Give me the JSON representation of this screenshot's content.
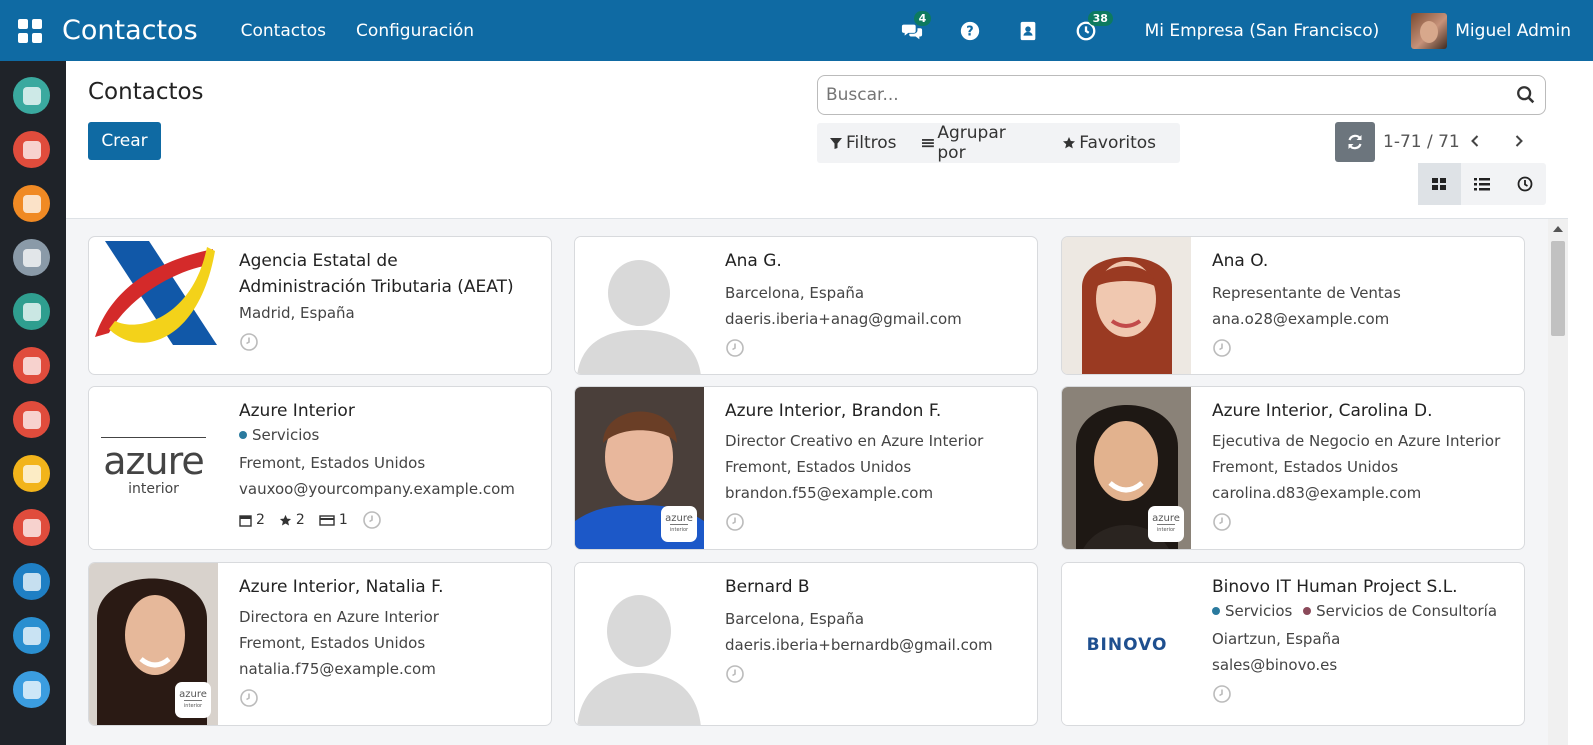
{
  "navbar": {
    "app_title": "Contactos",
    "menu": [
      "Contactos",
      "Configuración"
    ],
    "messages_badge": "4",
    "activities_badge": "38",
    "company": "Mi Empresa (San Francisco)",
    "user": "Miguel Admin"
  },
  "control": {
    "title": "Contactos",
    "create_label": "Crear",
    "search_placeholder": "Buscar...",
    "filters_label": "Filtros",
    "groupby_label": "Agrupar por",
    "favorites_label": "Favoritos",
    "pager": "1-71 / 71"
  },
  "sidebar_colors": [
    "#3aa99f",
    "#e04c3c",
    "#f08a24",
    "#8a9aa8",
    "#2f9e8f",
    "#e04c3c",
    "#e04c3c",
    "#f2b41b",
    "#e04c3c",
    "#1f7fc4",
    "#2a8fd0",
    "#3b9de0"
  ],
  "cards": [
    {
      "name": "Agencia Estatal de",
      "name2": "Administración Tributaria (AEAT)",
      "lines": [
        "Madrid, España"
      ]
    },
    {
      "name": "Ana G.",
      "lines": [
        "Barcelona, España",
        "daeris.iberia+anag@gmail.com"
      ]
    },
    {
      "name": "Ana O.",
      "lines": [
        "Representante de Ventas",
        "ana.o28@example.com"
      ]
    },
    {
      "name": "Azure Interior",
      "tags": [
        "Servicios"
      ],
      "lines": [
        "Fremont, Estados Unidos",
        "vauxoo@yourcompany.example.com"
      ],
      "stats": {
        "meetings": "2",
        "opportunities": "2",
        "invoices": "1"
      }
    },
    {
      "name": "Azure Interior, Brandon F.",
      "lines": [
        "Director Creativo en Azure Interior",
        "Fremont, Estados Unidos",
        "brandon.f55@example.com"
      ]
    },
    {
      "name": "Azure Interior, Carolina D.",
      "lines": [
        "Ejecutiva de Negocio en Azure Interior",
        "Fremont, Estados Unidos",
        "carolina.d83@example.com"
      ]
    },
    {
      "name": "Azure Interior, Natalia F.",
      "lines": [
        "Directora en Azure Interior",
        "Fremont, Estados Unidos",
        "natalia.f75@example.com"
      ]
    },
    {
      "name": "Bernard B",
      "lines": [
        "Barcelona, España",
        "daeris.iberia+bernardb@gmail.com"
      ]
    },
    {
      "name": "Binovo IT Human Project S.L.",
      "tags": [
        "Servicios",
        "Servicios de Consultoría"
      ],
      "lines": [
        "Oiartzun, España",
        "sales@binovo.es"
      ]
    }
  ],
  "logos": {
    "azure_main": "azure",
    "azure_sub": "interior",
    "binovo": "BINOVO"
  },
  "tag_colors": {
    "servicios": "#2a7a9e",
    "consultoria": "#8b4a5a"
  }
}
